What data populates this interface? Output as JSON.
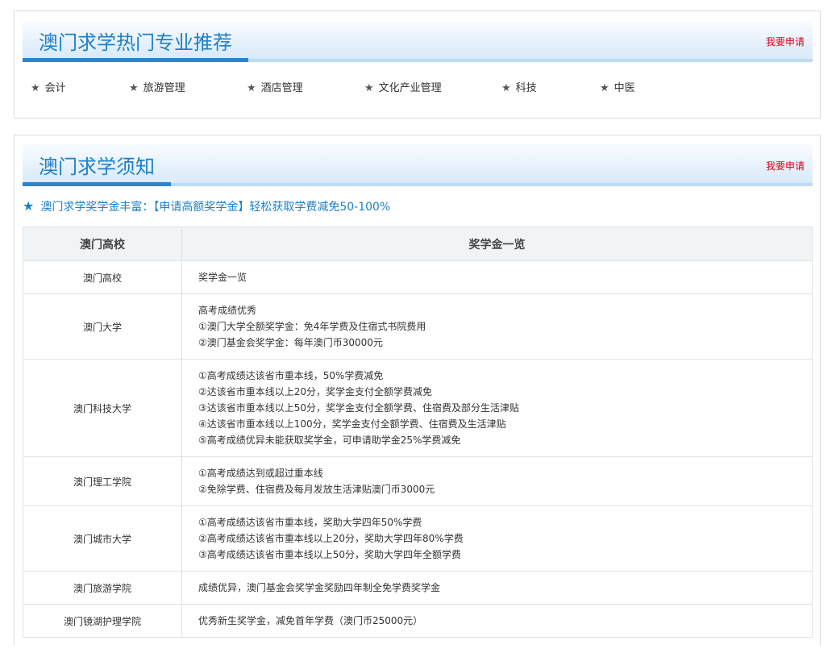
{
  "hot": {
    "title": "澳门求学热门专业推荐",
    "apply": "我要申请",
    "majors": [
      {
        "label": "会计"
      },
      {
        "label": "旅游管理"
      },
      {
        "label": "酒店管理"
      },
      {
        "label": "文化产业管理"
      },
      {
        "label": "科技"
      },
      {
        "label": "中医"
      }
    ]
  },
  "notice": {
    "title": "澳门求学须知",
    "apply": "我要申请",
    "scholar_prefix": "澳门求学奖学金丰富：",
    "scholar_link": "【申请高额奖学金】轻松获取学费减免50-100%",
    "table": {
      "headers": [
        "澳门高校",
        "奖学金一览"
      ],
      "rows": [
        {
          "school": "澳门高校",
          "lines": [
            "奖学金一览"
          ]
        },
        {
          "school": "澳门大学",
          "lines": [
            "高考成绩优秀",
            "①澳门大学全额奖学金：免4年学费及住宿式书院费用",
            "②澳门基金会奖学金：每年澳门币30000元"
          ]
        },
        {
          "school": "澳门科技大学",
          "lines": [
            "①高考成绩达该省市重本线，50%学费减免",
            "②达该省市重本线以上20分，奖学金支付全额学费减免",
            "③达该省市重本线以上50分，奖学金支付全额学费、住宿费及部分生活津贴",
            "④达该省市重本线以上100分，奖学金支付全额学费、住宿费及生活津贴",
            "⑤高考成绩优异未能获取奖学金，可申请助学金25%学费减免"
          ]
        },
        {
          "school": "澳门理工学院",
          "lines": [
            "①高考成绩达到或超过重本线",
            "②免除学费、住宿费及每月发放生活津贴澳门币3000元"
          ]
        },
        {
          "school": "澳门城市大学",
          "lines": [
            "①高考成绩达该省市重本线，奖助大学四年50%学费",
            "②高考成绩达该省市重本线以上20分，奖助大学四年80%学费",
            "③高考成绩达该省市重本线以上50分，奖助大学四年全额学费"
          ]
        },
        {
          "school": "澳门旅游学院",
          "lines": [
            "成绩优异，澳门基金会奖学金奖励四年制全免学费奖学金"
          ]
        },
        {
          "school": "澳门镜湖护理学院",
          "lines": [
            "优秀新生奖学金，减免首年学费（澳门币25000元）"
          ]
        }
      ]
    }
  }
}
